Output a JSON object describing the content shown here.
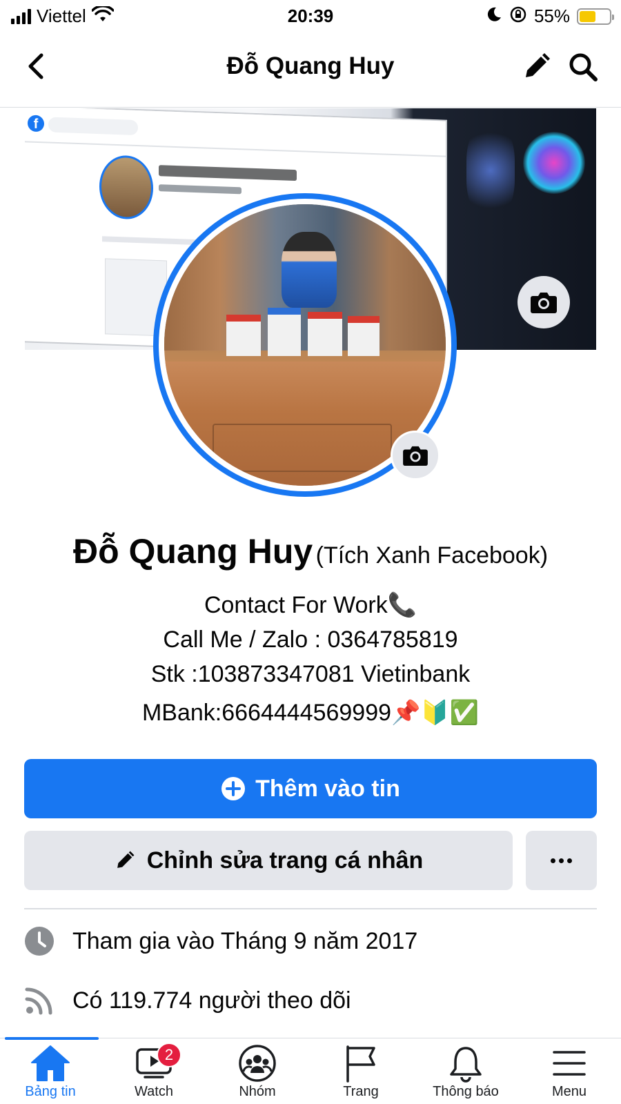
{
  "status_bar": {
    "carrier": "Viettel",
    "time": "20:39",
    "battery_percent": "55%",
    "battery_level": 0.55,
    "battery_color": "#f6c800"
  },
  "header": {
    "title": "Đỗ Quang Huy",
    "back_icon": "chevron-left-icon",
    "edit_icon": "pencil-icon",
    "search_icon": "search-icon"
  },
  "profile": {
    "name": "Đỗ Quang Huy",
    "alternate_name": "(Tích Xanh Facebook)",
    "bio_lines": [
      "Contact For Work📞",
      "Call Me / Zalo : 0364785819",
      "Stk :103873347081 Vietinbank",
      "MBank:6664444569999📌🔰✅"
    ]
  },
  "actions": {
    "add_story_label": "Thêm vào tin",
    "edit_profile_label": "Chỉnh sửa trang cá nhân",
    "more_icon": "more-horizontal-icon"
  },
  "intro": {
    "joined": "Tham gia vào Tháng 9 năm 2017",
    "followers": "Có 119.774 người theo dõi"
  },
  "tabbar": {
    "items": [
      {
        "label": "Bảng tin",
        "icon": "home-icon",
        "active": true
      },
      {
        "label": "Watch",
        "icon": "watch-video-icon",
        "badge": "2"
      },
      {
        "label": "Nhóm",
        "icon": "groups-icon"
      },
      {
        "label": "Trang",
        "icon": "flag-icon"
      },
      {
        "label": "Thông báo",
        "icon": "bell-icon"
      },
      {
        "label": "Menu",
        "icon": "hamburger-menu-icon"
      }
    ]
  },
  "colors": {
    "accent": "#1877f2",
    "badge": "#e41e3f",
    "secondary_button": "#e4e6eb"
  }
}
